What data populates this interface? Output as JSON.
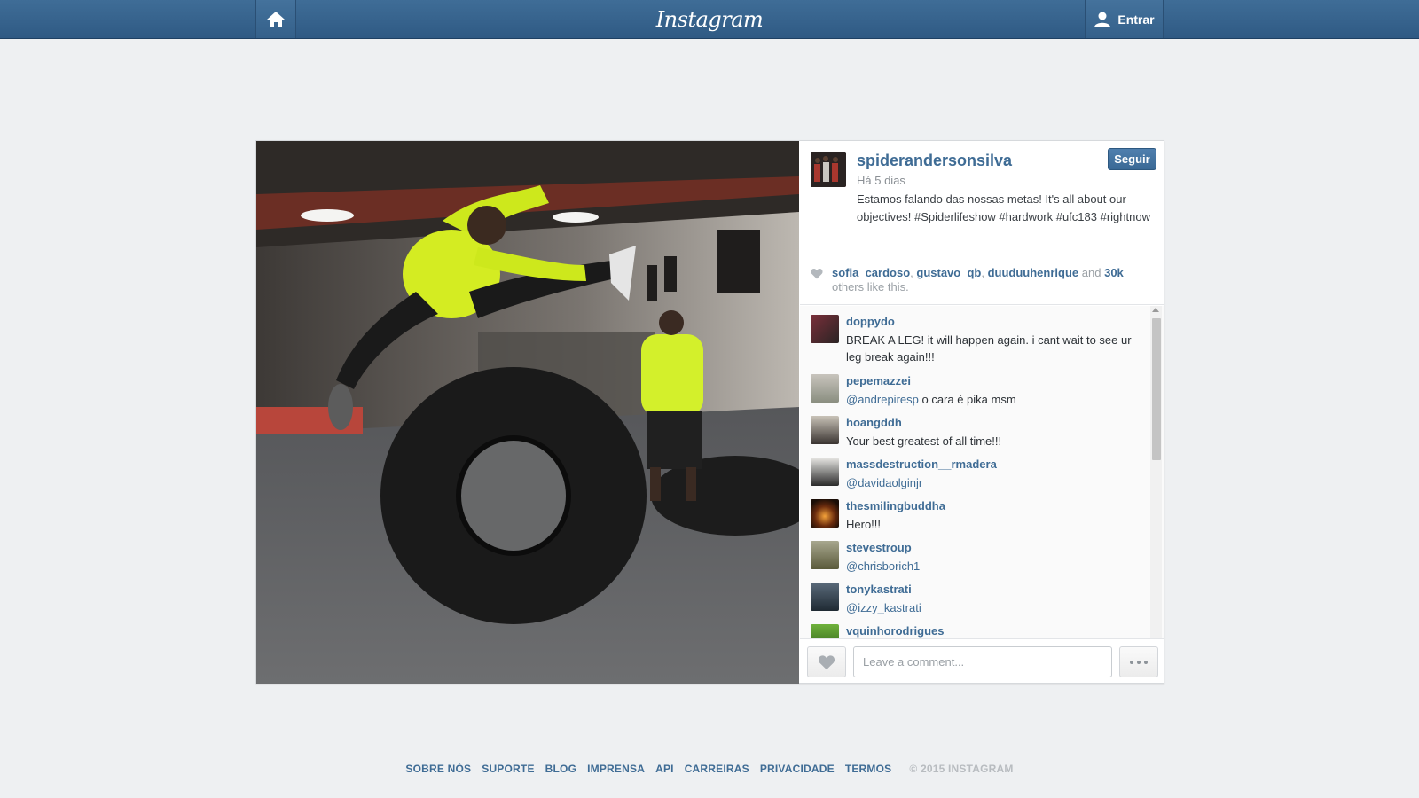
{
  "topbar": {
    "logo": "Instagram",
    "login_label": "Entrar",
    "home_icon": "home-icon",
    "user_icon": "user-icon"
  },
  "post": {
    "author": "spiderandersonsilva",
    "time": "Há 5 dias",
    "caption": "Estamos falando das nossas metas! It's all about our objectives! #Spiderlifeshow #hardwork #ufc183 #rightnow",
    "follow_label": "Seguir",
    "likes": {
      "users": [
        "sofia_cardoso",
        "gustavo_qb",
        "duuduuhenrique"
      ],
      "and": "and",
      "count": "30k",
      "suffix": "others like this."
    }
  },
  "comments": [
    {
      "user": "doppydo",
      "text": "BREAK A LEG! it will happen again. i cant wait to see ur leg break again!!!",
      "mention": ""
    },
    {
      "user": "pepemazzei",
      "mention": "@andrepiresp",
      "text": " o cara é pika msm"
    },
    {
      "user": "hoangddh",
      "text": "Your best greatest of all time!!!",
      "mention": ""
    },
    {
      "user": "massdestruction__rmadera",
      "mention": "@davidaolginjr",
      "text": ""
    },
    {
      "user": "thesmilingbuddha",
      "text": "Hero!!!",
      "mention": ""
    },
    {
      "user": "stevestroup",
      "mention": "@chrisborich1",
      "text": ""
    },
    {
      "user": "tonykastrati",
      "mention": "@izzy_kastrati",
      "text": ""
    },
    {
      "user": "vquinhorodrigues",
      "text": "",
      "mention": ""
    }
  ],
  "comment_box": {
    "placeholder": "Leave a comment..."
  },
  "footer": {
    "links": [
      "SOBRE NÓS",
      "SUPORTE",
      "BLOG",
      "IMPRENSA",
      "API",
      "CARREIRAS",
      "PRIVACIDADE",
      "TERMOS"
    ],
    "copyright": "© 2015 INSTAGRAM"
  },
  "colors": {
    "topbar": "#34608a",
    "link": "#3f6c95",
    "background": "#eef0f2"
  }
}
